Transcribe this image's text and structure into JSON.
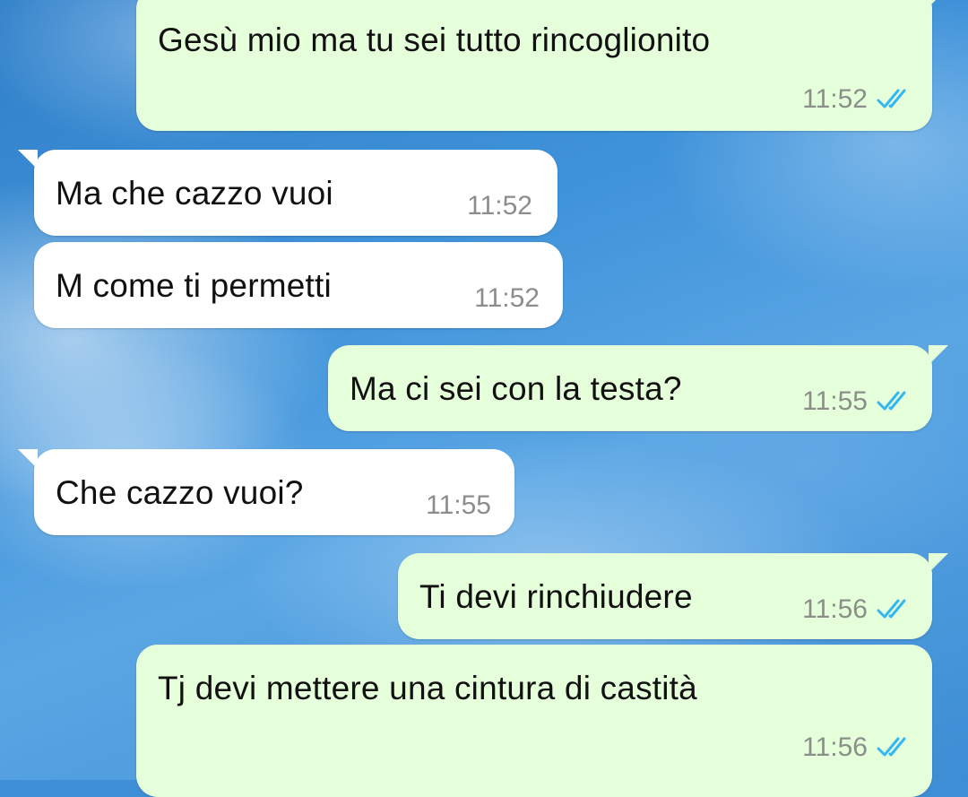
{
  "conversation": {
    "messages": [
      {
        "direction": "outgoing",
        "text": "Gesù mio ma tu sei tutto rincoglionito",
        "time": "11:52",
        "status_icon": "double-check-icon"
      },
      {
        "direction": "incoming",
        "text": "Ma che cazzo vuoi",
        "time": "11:52"
      },
      {
        "direction": "incoming",
        "text": "M come ti permetti",
        "time": "11:52"
      },
      {
        "direction": "outgoing",
        "text": "Ma ci sei con la testa?",
        "time": "11:55",
        "status_icon": "double-check-icon"
      },
      {
        "direction": "incoming",
        "text": "Che cazzo vuoi?",
        "time": "11:55"
      },
      {
        "direction": "outgoing",
        "text": "Ti devi rinchiudere",
        "time": "11:56",
        "status_icon": "double-check-icon"
      },
      {
        "direction": "outgoing",
        "text": "Tj devi mettere una cintura di castità",
        "time": "11:56",
        "status_icon": "double-check-icon"
      }
    ]
  },
  "colors": {
    "outgoing_bubble": "#e6ffdb",
    "incoming_bubble": "#ffffff",
    "read_ticks": "#34b7f1",
    "time_text": "#8a8f8a",
    "wallpaper": "#3f8fd6"
  }
}
